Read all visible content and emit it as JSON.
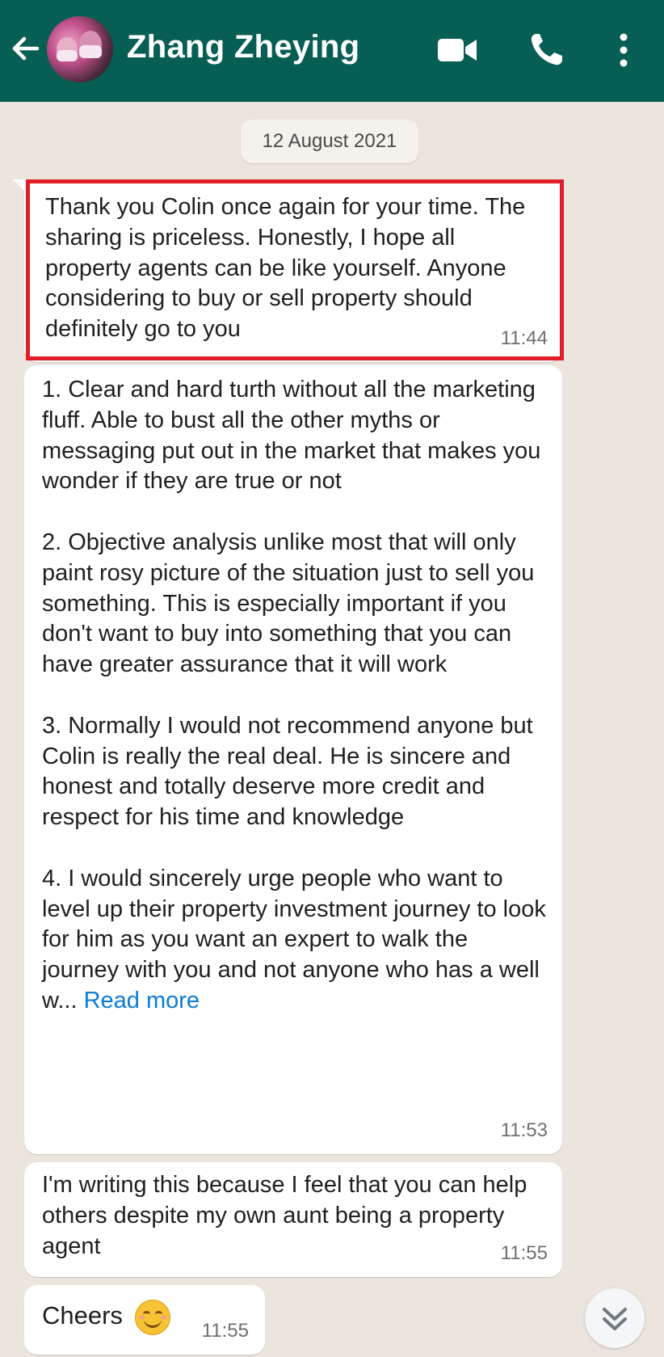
{
  "header": {
    "contact_name": "Zhang Zheying",
    "background_color": "#075e54",
    "icons": [
      "back-arrow-icon",
      "video-call-icon",
      "phone-icon",
      "more-options-icon"
    ]
  },
  "chat": {
    "date_chip": "12 August 2021",
    "messages": [
      {
        "text": "Thank you Colin once again for your time. The sharing is priceless. Honestly, I hope all property agents can be like yourself. Anyone considering to buy or sell property should definitely go to you",
        "time": "11:44",
        "highlighted": true
      },
      {
        "text": "1. Clear and hard turth without all the marketing fluff. Able to bust all the other myths or messaging put out in the market that makes you wonder if they are true or not\n\n2. Objective analysis unlike most that will only paint rosy picture of the situation just to sell you something. This is especially important if you don't want to buy into something that you can have greater assurance that it will work\n\n3. Normally I would not recommend anyone but Colin is really the real deal. He is sincere and honest and totally deserve more credit and respect for his time and knowledge\n\n4. I would sincerely urge people who want to level up their property investment journey to look for him as you want an expert to walk the journey with you and not anyone who has a well w...",
        "read_more": "Read more",
        "time": "11:53"
      },
      {
        "text": "I'm writing this because I feel that you can help others despite my own aunt being a property agent",
        "time": "11:55"
      },
      {
        "text": "Cheers",
        "emoji": "smiling-face-emoji",
        "time": "11:55"
      }
    ]
  },
  "scroll_button": {
    "icon": "double-chevron-down-icon"
  },
  "colors": {
    "highlight_border": "#e01e25",
    "read_more": "#0a7bd6",
    "chat_background": "#ece5dd"
  }
}
